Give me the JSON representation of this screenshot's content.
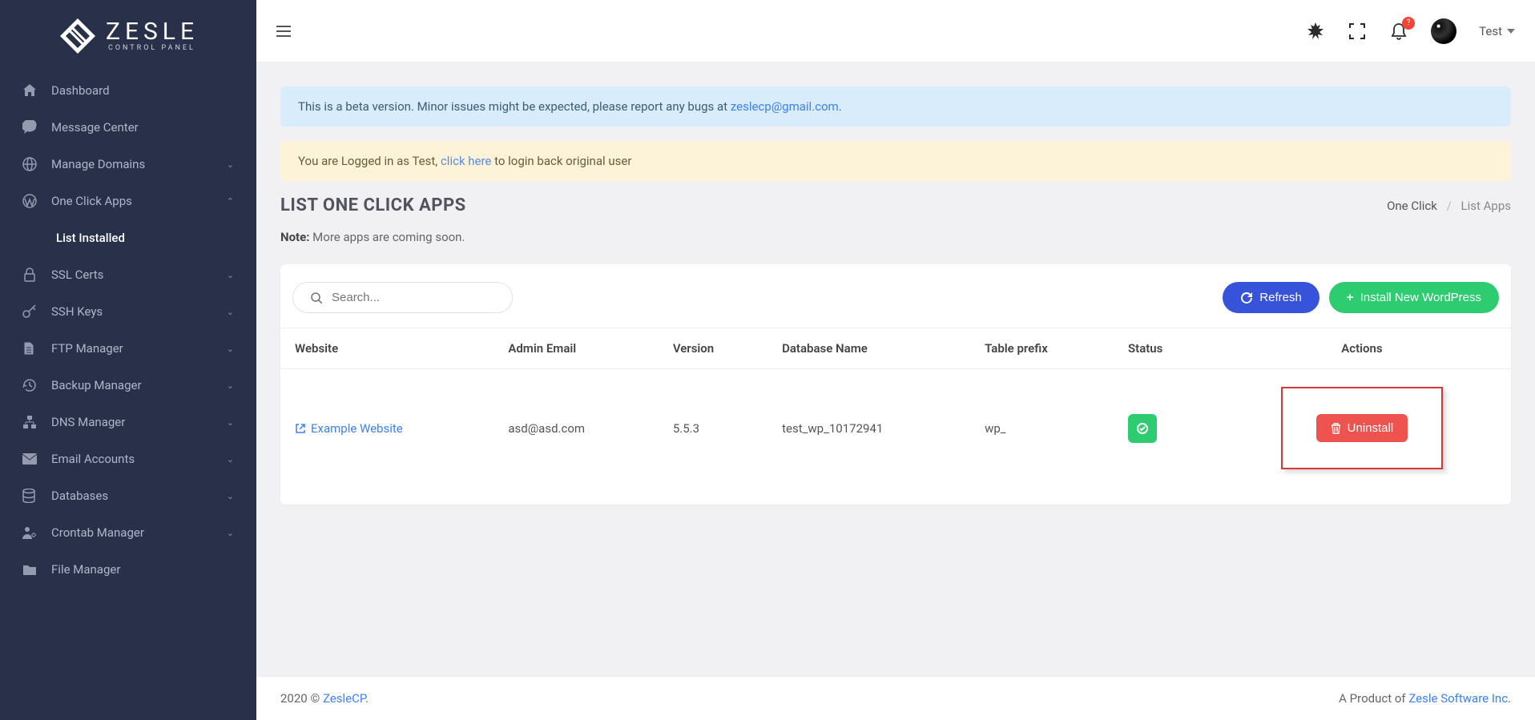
{
  "brand": {
    "name": "ZESLE",
    "sub": "CONTROL PANEL"
  },
  "sidebar": {
    "items": [
      {
        "icon": "dashboard",
        "label": "Dashboard",
        "expandable": false
      },
      {
        "icon": "message",
        "label": "Message Center",
        "expandable": false
      },
      {
        "icon": "globe",
        "label": "Manage Domains",
        "expandable": true,
        "open": false
      },
      {
        "icon": "wordpress",
        "label": "One Click Apps",
        "expandable": true,
        "open": true,
        "children": [
          {
            "label": "List Installed"
          }
        ]
      },
      {
        "icon": "lock",
        "label": "SSL Certs",
        "expandable": true,
        "open": false
      },
      {
        "icon": "key",
        "label": "SSH Keys",
        "expandable": true,
        "open": false
      },
      {
        "icon": "file",
        "label": "FTP Manager",
        "expandable": true,
        "open": false
      },
      {
        "icon": "history",
        "label": "Backup Manager",
        "expandable": true,
        "open": false
      },
      {
        "icon": "network",
        "label": "DNS Manager",
        "expandable": true,
        "open": false
      },
      {
        "icon": "mail",
        "label": "Email Accounts",
        "expandable": true,
        "open": false
      },
      {
        "icon": "database",
        "label": "Databases",
        "expandable": true,
        "open": false
      },
      {
        "icon": "usercog",
        "label": "Crontab Manager",
        "expandable": true,
        "open": false
      },
      {
        "icon": "folder",
        "label": "File Manager",
        "expandable": false
      }
    ]
  },
  "topbar": {
    "notification_badge": "?",
    "username": "Test"
  },
  "alerts": {
    "beta_pre": "This is a beta version. Minor issues might be expected, please report any bugs at ",
    "beta_email": "zeslecp@gmail.com",
    "beta_post": ".",
    "login_pre": "You are Logged in as Test, ",
    "login_link": "click here",
    "login_post": " to login back original user"
  },
  "page": {
    "title": "LIST ONE CLICK APPS",
    "breadcrumb_root": "One Click",
    "breadcrumb_current": "List Apps",
    "note_label": "Note:",
    "note_text": " More apps are coming soon."
  },
  "toolbar": {
    "search_placeholder": "Search...",
    "refresh_label": "Refresh",
    "install_label": "Install New WordPress"
  },
  "table": {
    "columns": [
      "Website",
      "Admin Email",
      "Version",
      "Database Name",
      "Table prefix",
      "Status",
      "Actions"
    ],
    "rows": [
      {
        "website": "Example Website",
        "admin_email": "asd@asd.com",
        "version": "5.5.3",
        "db_name": "test_wp_10172941",
        "prefix": "wp_",
        "status": "ok",
        "action_label": "Uninstall"
      }
    ]
  },
  "footer": {
    "year": "2020 © ",
    "brand": "ZesleCP",
    "dot": ".",
    "right_pre": "A Product of ",
    "right_link": "Zesle Software Inc.",
    "right_post": ""
  }
}
